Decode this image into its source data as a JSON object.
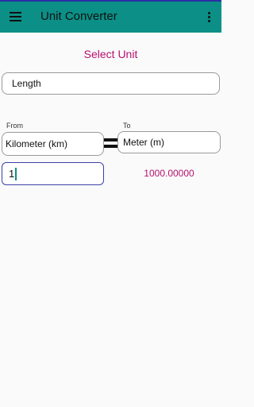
{
  "app": {
    "title": "Unit Converter"
  },
  "icons": {
    "menu": "hamburger-menu-icon",
    "overflow": "more-vertical-icon",
    "swap": "swap-icon"
  },
  "colors": {
    "appbar": "#0b8f86",
    "accent": "#b5106f",
    "input_focus": "#3b3fa8"
  },
  "main": {
    "heading": "Select Unit",
    "category": {
      "value": "Length"
    },
    "from": {
      "label": "From",
      "unit": "Kilometer (km)",
      "input": "1"
    },
    "to": {
      "label": "To",
      "unit": "Meter (m)"
    },
    "result": "1000.00000"
  }
}
